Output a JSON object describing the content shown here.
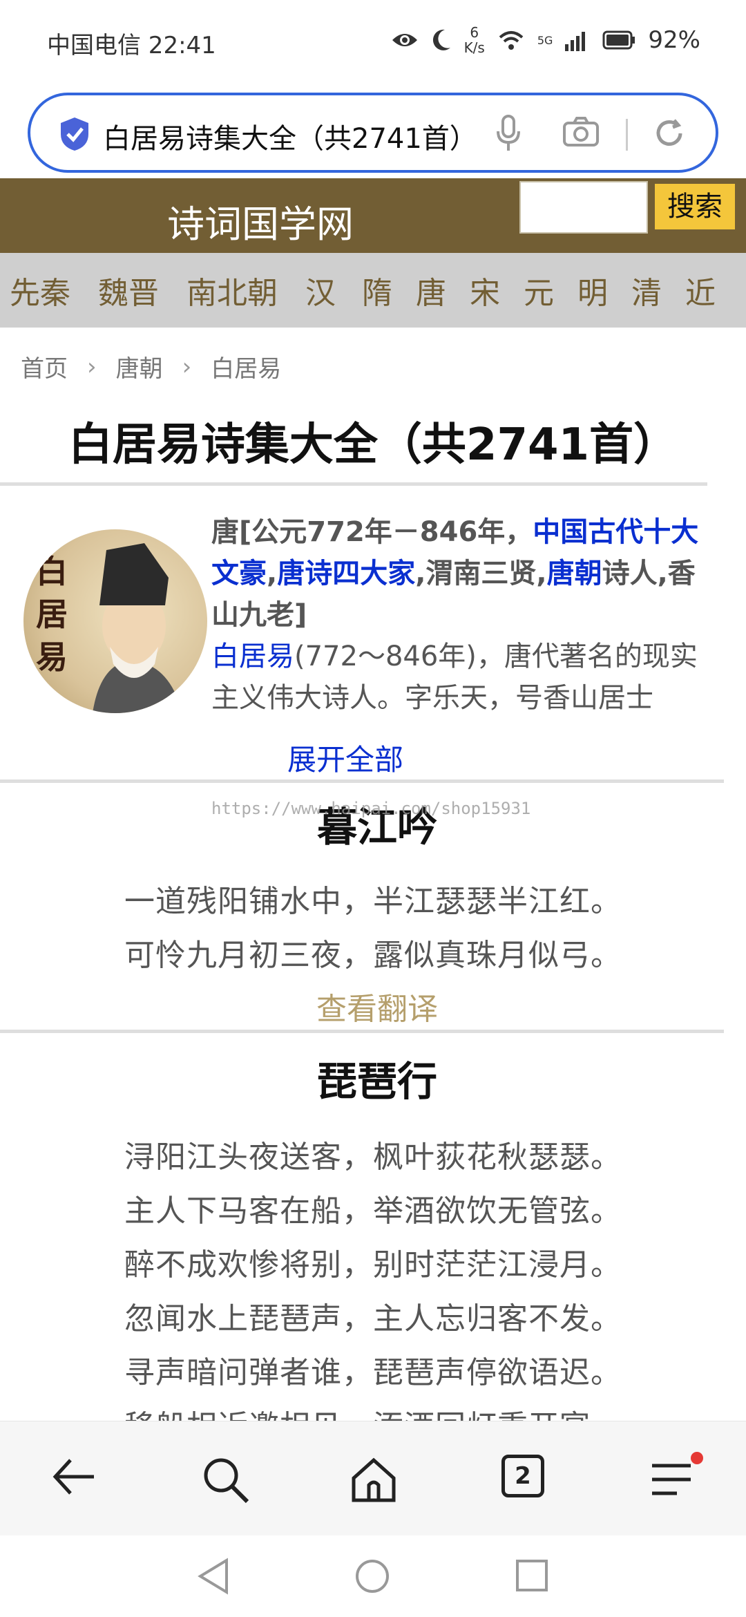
{
  "status_bar": {
    "carrier_time": "中国电信 22:41",
    "net_speed_value": "6",
    "net_speed_unit": "K/s",
    "network_label": "5G",
    "battery": "92%"
  },
  "address_bar": {
    "url_text": "白居易诗集大全（共2741首）"
  },
  "site_header": {
    "title": "诗词国学网",
    "search_button": "搜索"
  },
  "dynasty_nav": {
    "items": [
      "先秦",
      "魏晋",
      "南北朝",
      "汉",
      "隋",
      "唐",
      "宋",
      "元",
      "明",
      "清",
      "近"
    ]
  },
  "breadcrumb": {
    "items": [
      "首页",
      "唐朝",
      "白居易"
    ]
  },
  "page_title": "白居易诗集大全（共2741首）",
  "author": {
    "avatar_text": "白居易",
    "meta_part1": "唐[公元772年－846年，",
    "tag1": "中国古代十大文豪",
    "sep1": ",",
    "tag2": "唐诗四大家",
    "meta_part2": ",渭南三贤,",
    "tag3": "唐朝",
    "meta_part3": "诗人,香山九老]",
    "intro_name": "白居易",
    "intro_text": "(772～846年)，唐代著名的现实主义伟大诗人。字乐天，号香山居士",
    "expand": "展开全部"
  },
  "watermark": "https://www.haipai.com/shop15931",
  "poems": [
    {
      "title": "暮江吟",
      "lines": [
        "一道残阳铺水中，半江瑟瑟半江红。",
        "可怜九月初三夜，露似真珠月似弓。"
      ],
      "translate": "查看翻译"
    },
    {
      "title": "琵琶行",
      "lines": [
        "浔阳江头夜送客，枫叶荻花秋瑟瑟。",
        "主人下马客在船，举酒欲饮无管弦。",
        "醉不成欢惨将别，别时茫茫江浸月。",
        "忽闻水上琵琶声，主人忘归客不发。",
        "寻声暗问弹者谁，琵琶声停欲语迟。",
        "移船相近邀相见，添酒回灯重开宴。"
      ]
    }
  ],
  "bottom_bar": {
    "tab_count": "2"
  },
  "colors": {
    "header_brown": "#725e34",
    "search_yellow": "#f4c63b",
    "link_blue": "#0a2fd0",
    "translate_gold": "#b59f6c",
    "address_border": "#3366dd"
  }
}
